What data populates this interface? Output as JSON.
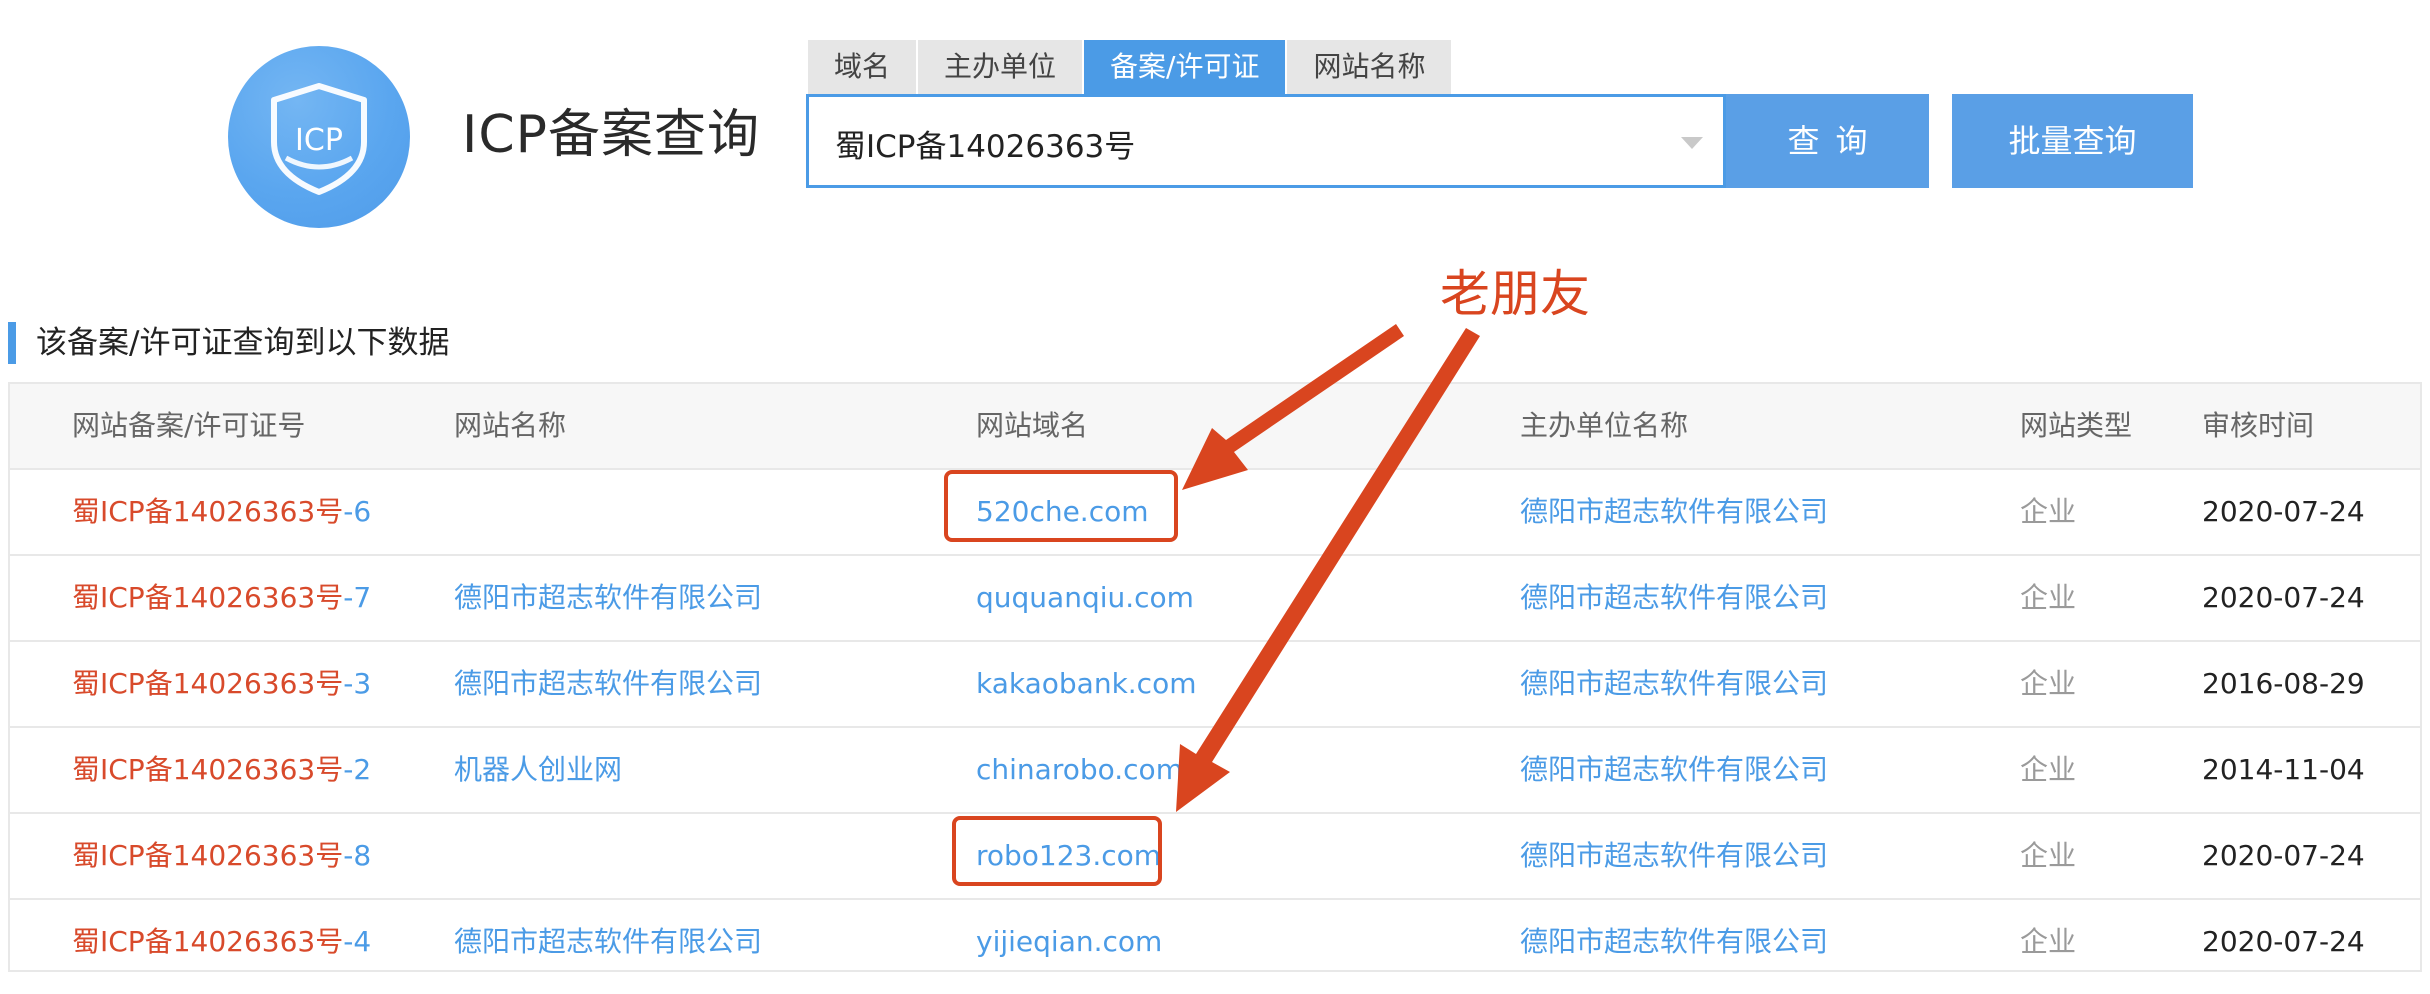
{
  "header": {
    "logo_text": "ICP",
    "title": "ICP备案查询"
  },
  "search": {
    "tabs": [
      {
        "label": "域名",
        "active": false
      },
      {
        "label": "主办单位",
        "active": false
      },
      {
        "label": "备案/许可证",
        "active": true
      },
      {
        "label": "网站名称",
        "active": false
      }
    ],
    "value": "蜀ICP备14026363号",
    "query_label": "查询",
    "batch_label": "批量查询"
  },
  "results": {
    "title": "该备案/许可证查询到以下数据",
    "columns": [
      "网站备案/许可证号",
      "网站名称",
      "网站域名",
      "主办单位名称",
      "网站类型",
      "审核时间"
    ],
    "rows": [
      {
        "license_base": "蜀ICP备14026363号",
        "license_suffix": "-6",
        "site_name": "",
        "domain": "520che.com",
        "org": "德阳市超志软件有限公司",
        "type": "企业",
        "date": "2020-07-24"
      },
      {
        "license_base": "蜀ICP备14026363号",
        "license_suffix": "-7",
        "site_name": "德阳市超志软件有限公司",
        "domain": "ququanqiu.com",
        "org": "德阳市超志软件有限公司",
        "type": "企业",
        "date": "2020-07-24"
      },
      {
        "license_base": "蜀ICP备14026363号",
        "license_suffix": "-3",
        "site_name": "德阳市超志软件有限公司",
        "domain": "kakaobank.com",
        "org": "德阳市超志软件有限公司",
        "type": "企业",
        "date": "2016-08-29"
      },
      {
        "license_base": "蜀ICP备14026363号",
        "license_suffix": "-2",
        "site_name": "机器人创业网",
        "domain": "chinarobo.com",
        "org": "德阳市超志软件有限公司",
        "type": "企业",
        "date": "2014-11-04"
      },
      {
        "license_base": "蜀ICP备14026363号",
        "license_suffix": "-8",
        "site_name": "",
        "domain": "robo123.com",
        "org": "德阳市超志软件有限公司",
        "type": "企业",
        "date": "2020-07-24"
      },
      {
        "license_base": "蜀ICP备14026363号",
        "license_suffix": "-4",
        "site_name": "德阳市超志软件有限公司",
        "domain": "yijieqian.com",
        "org": "德阳市超志软件有限公司",
        "type": "企业",
        "date": "2020-07-24"
      }
    ]
  },
  "annotation": {
    "text": "老朋友",
    "color": "#d9451f"
  },
  "colors": {
    "accent": "#4b9be6",
    "license_red": "#d84a2b"
  }
}
